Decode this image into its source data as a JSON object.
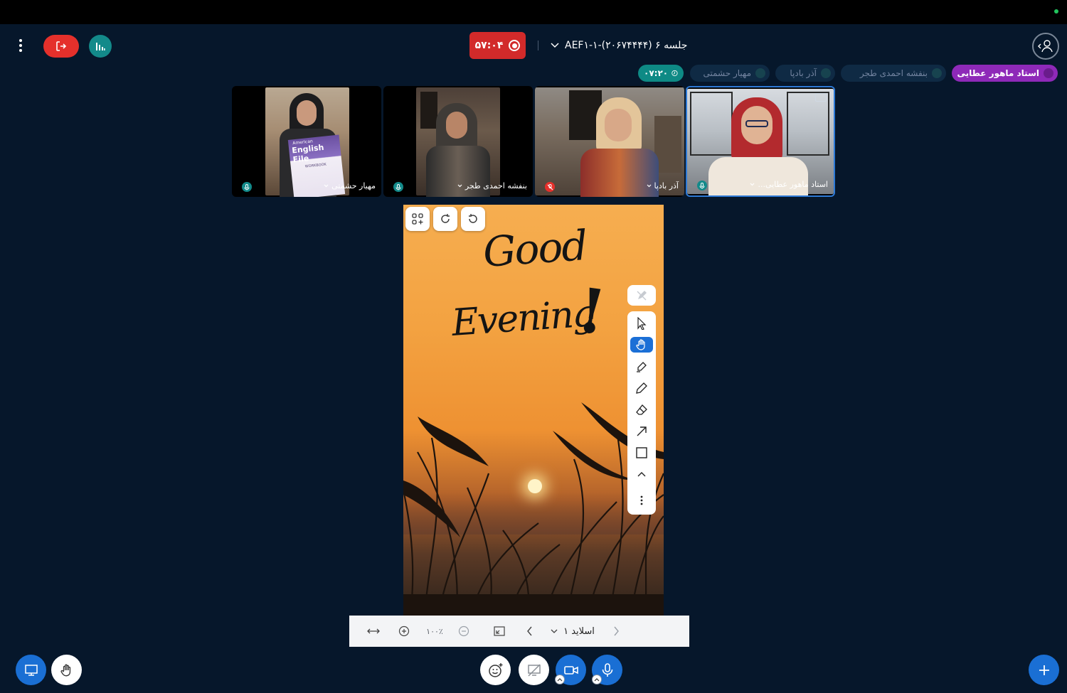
{
  "header": {
    "recording_time": "۵۷:۰۴",
    "session_title": "جلسه ۶ (۲۰۶۷۴۴۴۴)-AEF۱-۱"
  },
  "participants_bar": {
    "chips": [
      {
        "label": "استاد ماهور عطایی",
        "active": true
      },
      {
        "label": "بنفشه احمدی طجر",
        "active": false
      },
      {
        "label": "آذر بادپا",
        "active": false
      },
      {
        "label": "مهیار حشمتی",
        "active": false
      }
    ],
    "timer": "۰۷:۲۰"
  },
  "videos": [
    {
      "name": "مهیار حشمتی",
      "book_title": "English File",
      "book_brand": "American",
      "book_sub": "WORKBOOK"
    },
    {
      "name": "بنفشه احمدی طجر"
    },
    {
      "name": "آذر بادپا"
    },
    {
      "name": "استاد ماهور عطایی..."
    }
  ],
  "slide": {
    "line1": "Good",
    "line2": "Evening",
    "line3": "!"
  },
  "slide_nav": {
    "zoom": "۱۰۰٪",
    "current_slide": "اسلاید ۱"
  },
  "colors": {
    "background": "#06172b",
    "leave": "#e5302b",
    "record": "#d22a2a",
    "active_chip": "#8e29b8",
    "teal": "#138a8a",
    "primary_blue": "#1a6fd4"
  }
}
